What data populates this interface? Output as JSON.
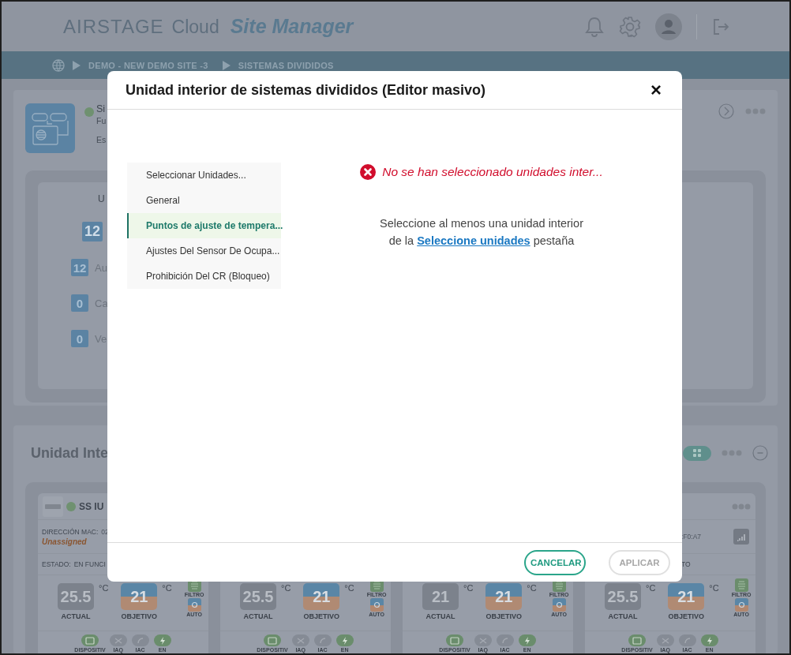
{
  "header": {
    "brand": "AIRSTAGE",
    "product": "Cloud",
    "app_name": "Site Manager"
  },
  "breadcrumb": [
    "DEMO - NEW DEMO SITE -3",
    "SISTEMAS DIVIDIDOS"
  ],
  "site_panel": {
    "name": "Si",
    "line_2": "Fu",
    "line_3": "Es",
    "summary": {
      "heading": "U",
      "total": "12",
      "rows": [
        {
          "count": "12",
          "label": "Au"
        },
        {
          "count": "0",
          "label": "Ca"
        },
        {
          "count": "0",
          "label": "Ve"
        }
      ]
    }
  },
  "units_panel": {
    "title": "Unidad Inte",
    "grid_view_selected": true,
    "cards": [
      {
        "name": "SS IU",
        "mac_label": "DIRECCIÓN MAC:",
        "mac_value": "02",
        "mac_note": "Unassigned",
        "state_label": "ESTADO:",
        "state_value": "EN FUNCI",
        "actual": "25.5",
        "target": "21",
        "unit": "°C",
        "target_unit": "°C",
        "actual_label": "ACTUAL",
        "target_label": "OBJETIVO",
        "modes": [
          {
            "label": "FILTRO",
            "kind": "filter"
          },
          {
            "label": "AUTO",
            "kind": "auto"
          }
        ],
        "features": [
          {
            "label": "DISPOSITIV",
            "kind": "device",
            "on": true
          },
          {
            "label": "IAQ",
            "kind": "iaq",
            "on": false
          },
          {
            "label": "IAC",
            "kind": "iac",
            "on": false
          },
          {
            "label": "EN",
            "kind": "energy",
            "on": true
          }
        ]
      },
      {
        "actual": "25.5",
        "target": "21",
        "unit": "°C",
        "target_unit": "°C",
        "actual_label": "ACTUAL",
        "target_label": "OBJETIVO",
        "modes": [
          {
            "label": "FILTRO",
            "kind": "filter"
          },
          {
            "label": "AUTO",
            "kind": "auto"
          }
        ],
        "features": [
          {
            "label": "DISPOSITIV",
            "kind": "device",
            "on": true
          },
          {
            "label": "IAQ",
            "kind": "iaq",
            "on": false
          },
          {
            "label": "IAC",
            "kind": "iac",
            "on": false
          },
          {
            "label": "EN",
            "kind": "energy",
            "on": true
          }
        ]
      },
      {
        "actual": "21",
        "target": "21",
        "unit": "°C",
        "target_unit": "°C",
        "actual_label": "ACTUAL",
        "target_label": "OBJETIVO",
        "modes": [
          {
            "label": "FILTRO",
            "kind": "filter"
          },
          {
            "label": "AUTO",
            "kind": "auto"
          }
        ],
        "features": [
          {
            "label": "DISPOSITIV",
            "kind": "device",
            "on": true
          },
          {
            "label": "IAQ",
            "kind": "iaq",
            "on": false
          },
          {
            "label": "IAC",
            "kind": "iac",
            "on": false
          },
          {
            "label": "EN",
            "kind": "energy",
            "on": true
          }
        ]
      },
      {
        "menu": true,
        "mac_value": ":F0:A7",
        "signal": true,
        "state_value": "TO",
        "actual": "25.5",
        "target": "21",
        "unit": "°C",
        "target_unit": "°C",
        "actual_label": "ACTUAL",
        "target_label": "OBJETIVO",
        "modes": [
          {
            "label": "FILTRO",
            "kind": "filter"
          },
          {
            "label": "AUTO",
            "kind": "auto"
          }
        ],
        "features": [
          {
            "label": "DISPOSITIV",
            "kind": "device",
            "on": true
          },
          {
            "label": "IAQ",
            "kind": "iaq",
            "on": false
          },
          {
            "label": "IAC",
            "kind": "iac",
            "on": false
          },
          {
            "label": "EN",
            "kind": "energy",
            "on": true
          }
        ]
      }
    ]
  },
  "modal": {
    "title": "Unidad interior de sistemas divididos (Editor masivo)",
    "close": "×",
    "tabs": [
      {
        "label": "Seleccionar Unidades...",
        "selected": false
      },
      {
        "label": "General",
        "selected": false
      },
      {
        "label": "Puntos de ajuste de tempera...",
        "selected": true
      },
      {
        "label": "Ajustes Del Sensor De Ocupa...",
        "selected": false
      },
      {
        "label": "Prohibición Del CR (Bloqueo)",
        "selected": false
      }
    ],
    "error": "No se han seleccionado unidades inter...",
    "instruction": {
      "line_1": "Seleccione al menos una unidad interior",
      "before_link": "de la",
      "link": "Seleccione unidades",
      "after_link": "pestaña"
    },
    "buttons": [
      {
        "label": "CANCELAR",
        "disabled": false
      },
      {
        "label": "APLICAR",
        "disabled": true
      }
    ]
  }
}
